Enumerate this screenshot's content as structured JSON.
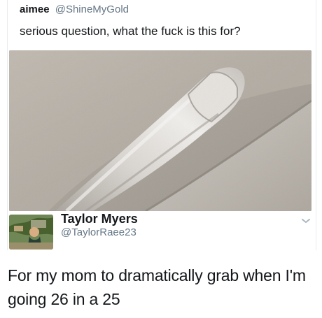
{
  "original_tweet": {
    "display_name": "aimee",
    "handle": "@ShineMyGold",
    "text": "serious question, what the fuck is this for?",
    "photo_description_icon": "car-grab-handle-photo"
  },
  "reply_tweet": {
    "display_name": "Taylor Myers",
    "handle": "@TaylorRaee23",
    "text": "For my mom to dramatically grab when I'm going 26 in a 25",
    "avatar_icon": "profile-avatar",
    "menu_icon": "chevron-down-icon"
  },
  "colors": {
    "text_primary": "#14171a",
    "text_secondary": "#657786",
    "border": "#e6ecf0",
    "photo_ceiling": "#b8b1a7",
    "photo_handle": "#ddd9d4"
  }
}
